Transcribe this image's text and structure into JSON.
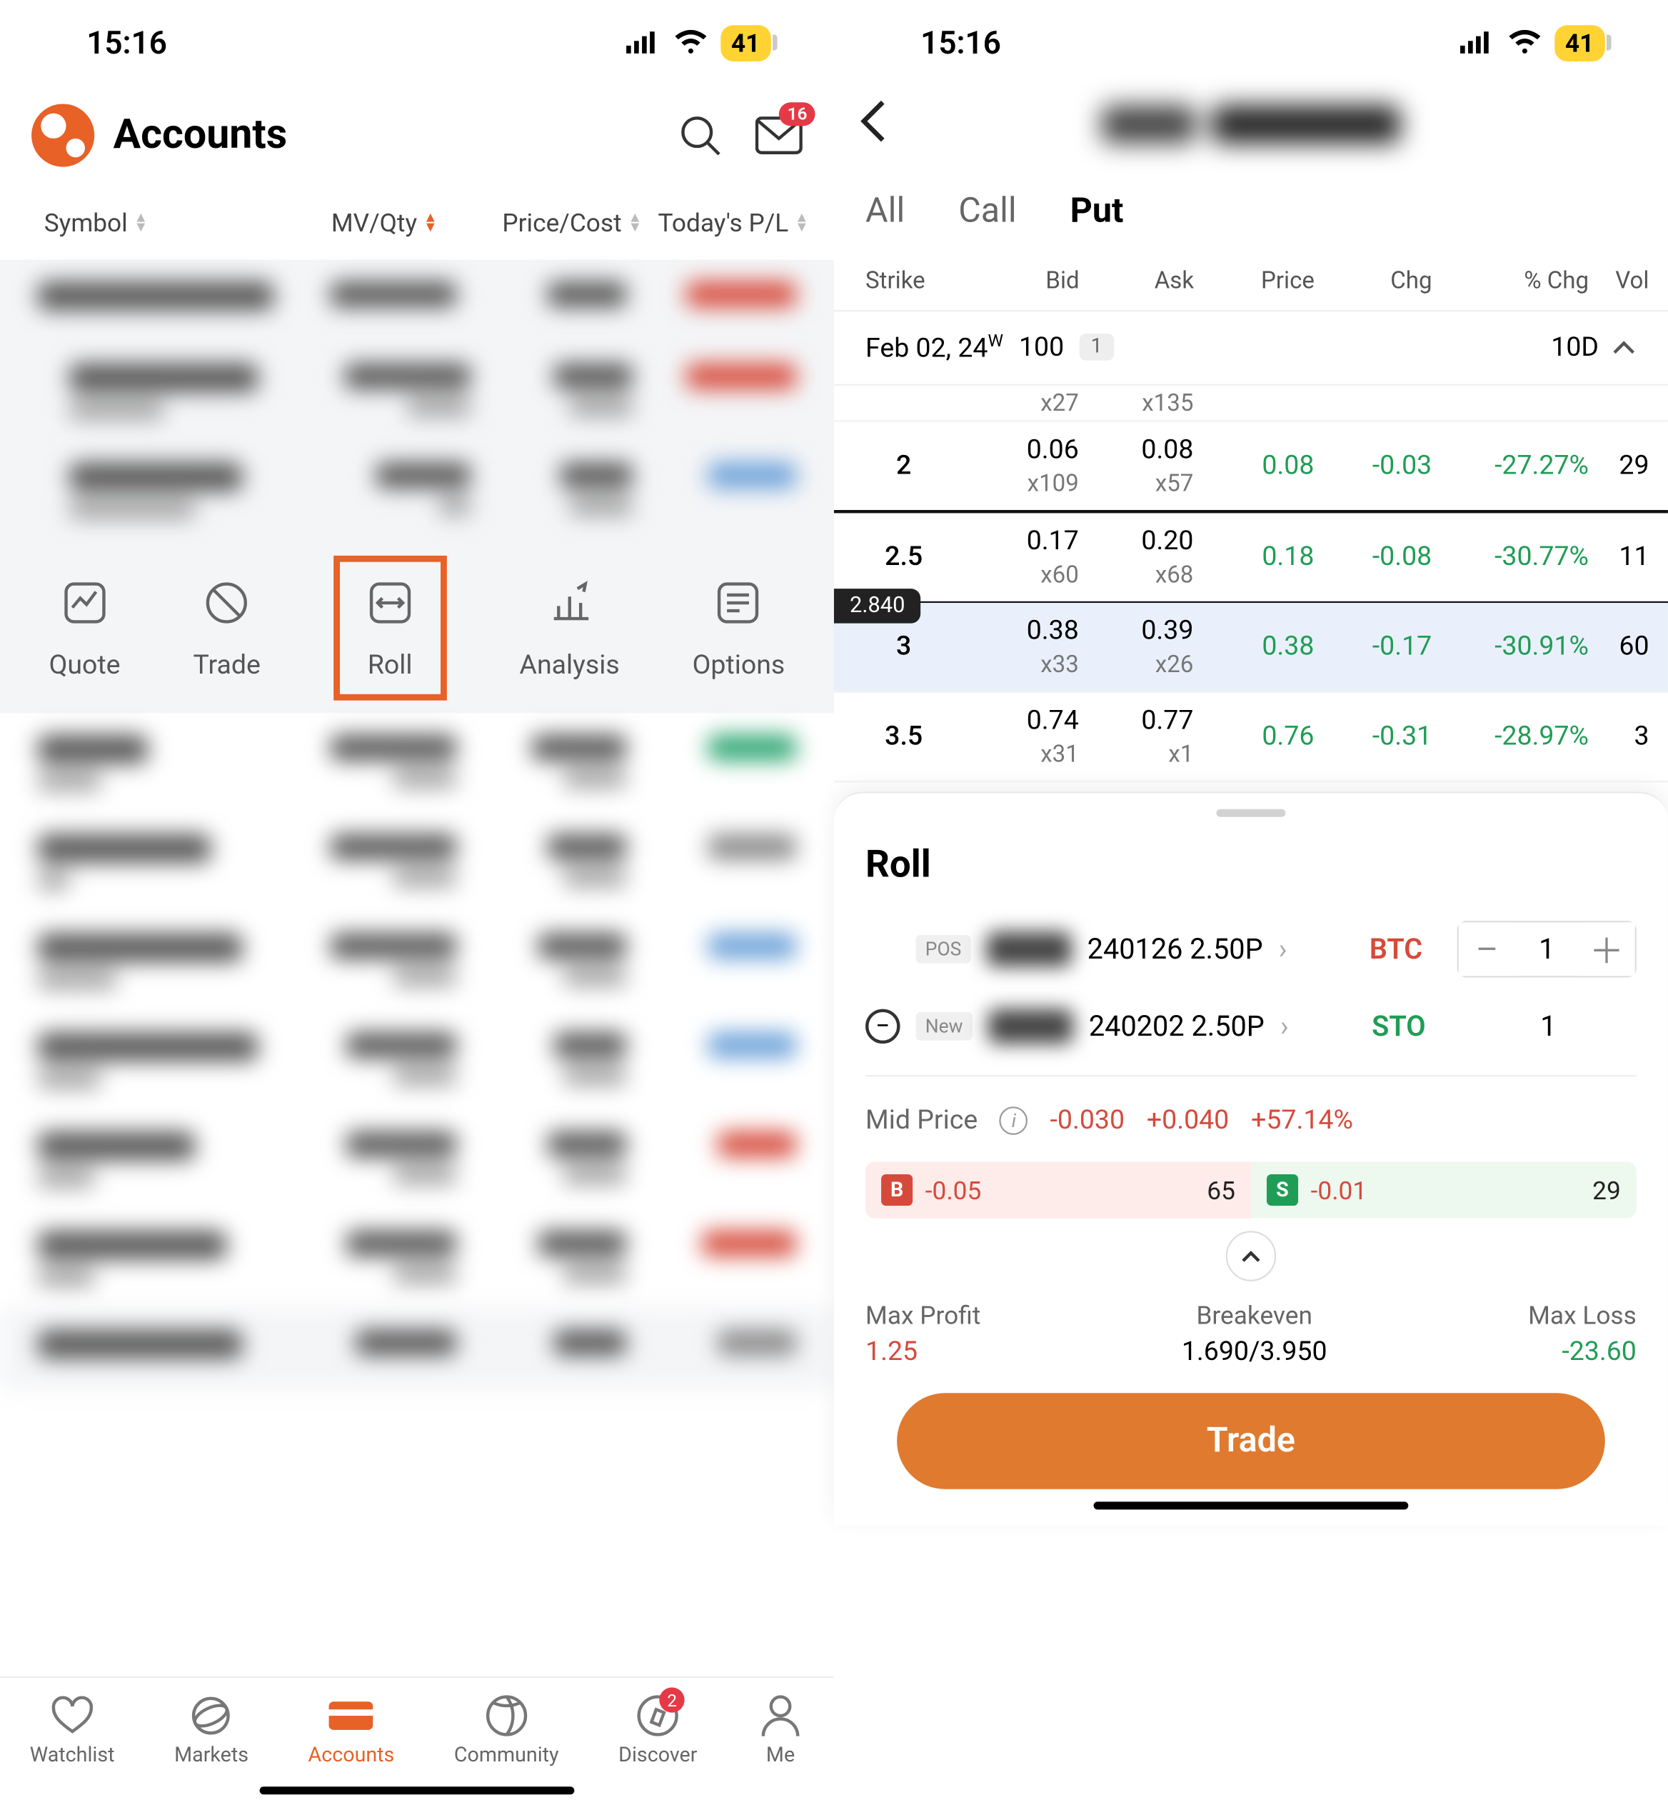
{
  "status": {
    "time": "15:16",
    "battery": "41"
  },
  "left": {
    "title": "Accounts",
    "mail_badge": "16",
    "columns": {
      "symbol": "Symbol",
      "mvqty": "MV/Qty",
      "pricecost": "Price/Cost",
      "pl": "Today's P/L"
    },
    "actions": {
      "quote": "Quote",
      "trade": "Trade",
      "roll": "Roll",
      "analysis": "Analysis",
      "options": "Options"
    },
    "tabs": {
      "watchlist": "Watchlist",
      "markets": "Markets",
      "accounts": "Accounts",
      "community": "Community",
      "discover": "Discover",
      "me": "Me"
    },
    "discover_badge": "2"
  },
  "right": {
    "opt_tabs": {
      "all": "All",
      "call": "Call",
      "put": "Put"
    },
    "chain_header": {
      "strike": "Strike",
      "bid": "Bid",
      "ask": "Ask",
      "price": "Price",
      "chg": "Chg",
      "pchg": "% Chg",
      "vol": "Vol"
    },
    "expiry": {
      "date": "Feb 02, 24",
      "week": "W",
      "mult": "100",
      "count": "1",
      "days": "10D"
    },
    "peek": {
      "bid_sz": "x27",
      "ask_sz": "x135"
    },
    "rows": [
      {
        "strike": "2",
        "bid": "0.06",
        "bid_sz": "x109",
        "ask": "0.08",
        "ask_sz": "x57",
        "price": "0.08",
        "chg": "-0.03",
        "pchg": "-27.27%",
        "vol": "29"
      },
      {
        "strike": "2.5",
        "bid": "0.17",
        "bid_sz": "x60",
        "ask": "0.20",
        "ask_sz": "x68",
        "price": "0.18",
        "chg": "-0.08",
        "pchg": "-30.77%",
        "vol": "11",
        "selected": true,
        "bubble": "2.840"
      },
      {
        "strike": "3",
        "bid": "0.38",
        "bid_sz": "x33",
        "ask": "0.39",
        "ask_sz": "x26",
        "price": "0.38",
        "chg": "-0.17",
        "pchg": "-30.91%",
        "vol": "60",
        "hl": true
      },
      {
        "strike": "3.5",
        "bid": "0.74",
        "bid_sz": "x31",
        "ask": "0.77",
        "ask_sz": "x1",
        "price": "0.76",
        "chg": "-0.31",
        "pchg": "-28.97%",
        "vol": "3"
      }
    ],
    "sheet": {
      "title": "Roll",
      "pos_tag": "POS",
      "new_tag": "New",
      "leg1": "240126 2.50P",
      "leg2": "240202 2.50P",
      "btc": "BTC",
      "sto": "STO",
      "qty1": "1",
      "qty2": "1",
      "mid_label": "Mid Price",
      "mid_v1": "-0.030",
      "mid_v2": "+0.040",
      "mid_v3": "+57.14%",
      "b_val": "-0.05",
      "b_num": "65",
      "s_val": "-0.01",
      "s_num": "29",
      "max_profit_label": "Max Profit",
      "max_profit": "1.25",
      "breakeven_label": "Breakeven",
      "breakeven": "1.690/3.950",
      "max_loss_label": "Max Loss",
      "max_loss": "-23.60",
      "trade_btn": "Trade"
    }
  }
}
